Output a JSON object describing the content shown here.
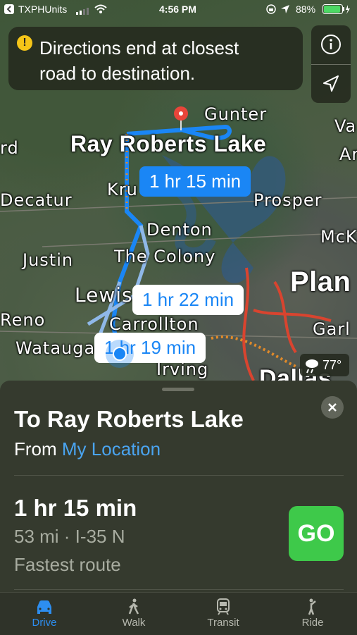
{
  "status_bar": {
    "carrier": "TXPHUnits",
    "time": "4:56 PM",
    "battery": "88%"
  },
  "banner": {
    "line1": "Directions end at closest",
    "line2": "road to destination.",
    "icon": "warning-icon"
  },
  "map_controls": {
    "info_icon": "info-icon",
    "location_icon": "location-arrow-icon"
  },
  "map": {
    "destination": "Ray Roberts Lake",
    "labels": [
      "Gunter",
      "Va",
      "rd",
      "Decatur",
      "Kru",
      "Prosper",
      "Denton",
      "McK",
      "Justin",
      "The Colony",
      "Lewis",
      "Plan",
      "Reno",
      "Carrollton",
      "Garl",
      "Watauga",
      "Irving",
      "Dallas",
      "Ar"
    ],
    "route_bubbles": {
      "primary": "1 hr 15 min",
      "alt1": "1 hr 22 min",
      "alt2": "1 hr 19 min"
    },
    "weather": "77°"
  },
  "sheet": {
    "title": "To Ray Roberts Lake",
    "from_prefix": "From ",
    "from_link": "My Location",
    "duration": "1 hr 15 min",
    "distance": "53 mi · I-35 N",
    "note": "Fastest route",
    "go": "GO"
  },
  "tabs": [
    {
      "label": "Drive",
      "icon": "car-icon",
      "active": true
    },
    {
      "label": "Walk",
      "icon": "walk-icon",
      "active": false
    },
    {
      "label": "Transit",
      "icon": "train-icon",
      "active": false
    },
    {
      "label": "Ride",
      "icon": "ride-icon",
      "active": false
    }
  ],
  "colors": {
    "accent": "#1a86f5",
    "go": "#3ec94a",
    "link": "#4aa4f0"
  }
}
